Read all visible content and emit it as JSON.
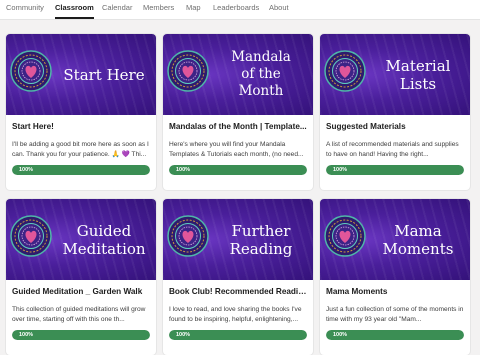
{
  "nav": {
    "tabs": [
      {
        "label": "Community",
        "active": false
      },
      {
        "label": "Classroom",
        "active": true
      },
      {
        "label": "Calendar",
        "active": false
      },
      {
        "label": "Members",
        "active": false
      },
      {
        "label": "Map",
        "active": false
      },
      {
        "label": "Leaderboards",
        "active": false
      },
      {
        "label": "About",
        "active": false
      }
    ]
  },
  "courses": [
    {
      "cover_text": "Start Here",
      "title": "Start Here!",
      "description": "I'll be adding a good bit more here as soon as I can. Thank you for your patience. 🙏 💜 Thi...",
      "progress": 100,
      "progress_label": "100%"
    },
    {
      "cover_text": "Mandala\nof the\nMonth",
      "title": "Mandalas of the Month | Template...",
      "description": "Here's where you will find your Mandala Templates & Tutorials each month, (no need...",
      "progress": 100,
      "progress_label": "100%"
    },
    {
      "cover_text": "Material\nLists",
      "title": "Suggested Materials",
      "description": "A list of recommended materials and supplies to have on hand! Having the right...",
      "progress": 100,
      "progress_label": "100%"
    },
    {
      "cover_text": "Guided\nMeditation",
      "title": "Guided Meditation _ Garden Walk",
      "description": "This collection of guided meditations will grow over time, starting off with this one th...",
      "progress": 100,
      "progress_label": "100%"
    },
    {
      "cover_text": "Further\nReading",
      "title": "Book Club! Recommended Reading",
      "description": "I love to read, and love sharing the books I've found to be inspiring, helpful, enlightening,...",
      "progress": 100,
      "progress_label": "100%"
    },
    {
      "cover_text": "Mama\nMoments",
      "title": "Mama Moments",
      "description": "Just a fun collection of some of the moments in time with my 93 year old \"Mam...",
      "progress": 100,
      "progress_label": "100%"
    }
  ],
  "colors": {
    "cover_purple": "#4a1f9b",
    "progress_green": "#3b8e54",
    "heart_pink": "#e0569a"
  },
  "icons": {
    "cover_emblem": "mandala-heart-icon"
  }
}
